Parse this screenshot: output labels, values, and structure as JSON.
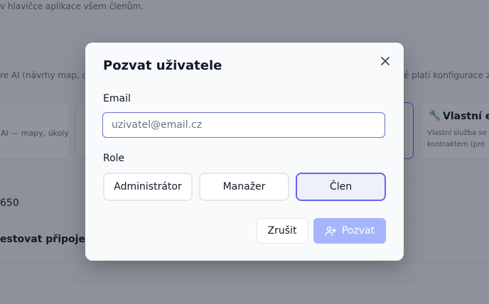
{
  "background": {
    "top_text": "v hlavičce aplikace všem členům.",
    "ai_text_left": "re AI (návrhy map, ch",
    "ai_text_right": "é platí konfigurace ze",
    "card_left_desc": "AI — mapy, úkoly",
    "card_right_title": "Vlastní en",
    "card_right_desc_1": "Vlastní služba se",
    "card_right_desc_2": "kontraktem (pro",
    "field_value": "650",
    "test_connection": "estovat připojení"
  },
  "modal": {
    "title": "Pozvat uživatele",
    "email_label": "Email",
    "email_placeholder": "uzivatel@email.cz",
    "email_value": "",
    "role_label": "Role",
    "roles": [
      {
        "label": "Administrátor",
        "selected": false
      },
      {
        "label": "Manažer",
        "selected": false
      },
      {
        "label": "Člen",
        "selected": true
      }
    ],
    "cancel_label": "Zrušit",
    "invite_label": "Pozvat",
    "colors": {
      "accent": "#6366f1",
      "invite_disabled": "#a5b4fc",
      "selected_role_bg": "#eef0fb"
    }
  }
}
